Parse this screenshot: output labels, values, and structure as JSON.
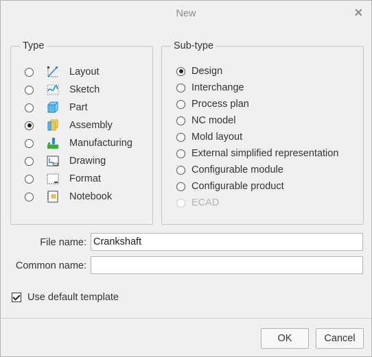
{
  "window": {
    "title": "New"
  },
  "type_group": {
    "label": "Type",
    "items": [
      {
        "label": "Layout",
        "icon": "layout-icon",
        "selected": false
      },
      {
        "label": "Sketch",
        "icon": "sketch-icon",
        "selected": false
      },
      {
        "label": "Part",
        "icon": "part-icon",
        "selected": false
      },
      {
        "label": "Assembly",
        "icon": "assembly-icon",
        "selected": true
      },
      {
        "label": "Manufacturing",
        "icon": "manufacturing-icon",
        "selected": false
      },
      {
        "label": "Drawing",
        "icon": "drawing-icon",
        "selected": false
      },
      {
        "label": "Format",
        "icon": "format-icon",
        "selected": false
      },
      {
        "label": "Notebook",
        "icon": "notebook-icon",
        "selected": false
      }
    ]
  },
  "subtype_group": {
    "label": "Sub-type",
    "items": [
      {
        "label": "Design",
        "selected": true,
        "enabled": true
      },
      {
        "label": "Interchange",
        "selected": false,
        "enabled": true
      },
      {
        "label": "Process plan",
        "selected": false,
        "enabled": true
      },
      {
        "label": "NC model",
        "selected": false,
        "enabled": true
      },
      {
        "label": "Mold layout",
        "selected": false,
        "enabled": true
      },
      {
        "label": "External simplified representation",
        "selected": false,
        "enabled": true
      },
      {
        "label": "Configurable module",
        "selected": false,
        "enabled": true
      },
      {
        "label": "Configurable product",
        "selected": false,
        "enabled": true
      },
      {
        "label": "ECAD",
        "selected": false,
        "enabled": false
      }
    ]
  },
  "fields": {
    "file_name_label": "File name:",
    "file_name_value": "Crankshaft",
    "common_name_label": "Common name:",
    "common_name_value": ""
  },
  "options": {
    "use_default_template_label": "Use default template",
    "use_default_template_checked": true
  },
  "buttons": {
    "ok": "OK",
    "cancel": "Cancel"
  },
  "colors": {
    "accent_blue": "#1a8fd8",
    "icon_yellow": "#f2c94c",
    "icon_green": "#3cab3c",
    "border_gray": "#b4b4b4"
  }
}
